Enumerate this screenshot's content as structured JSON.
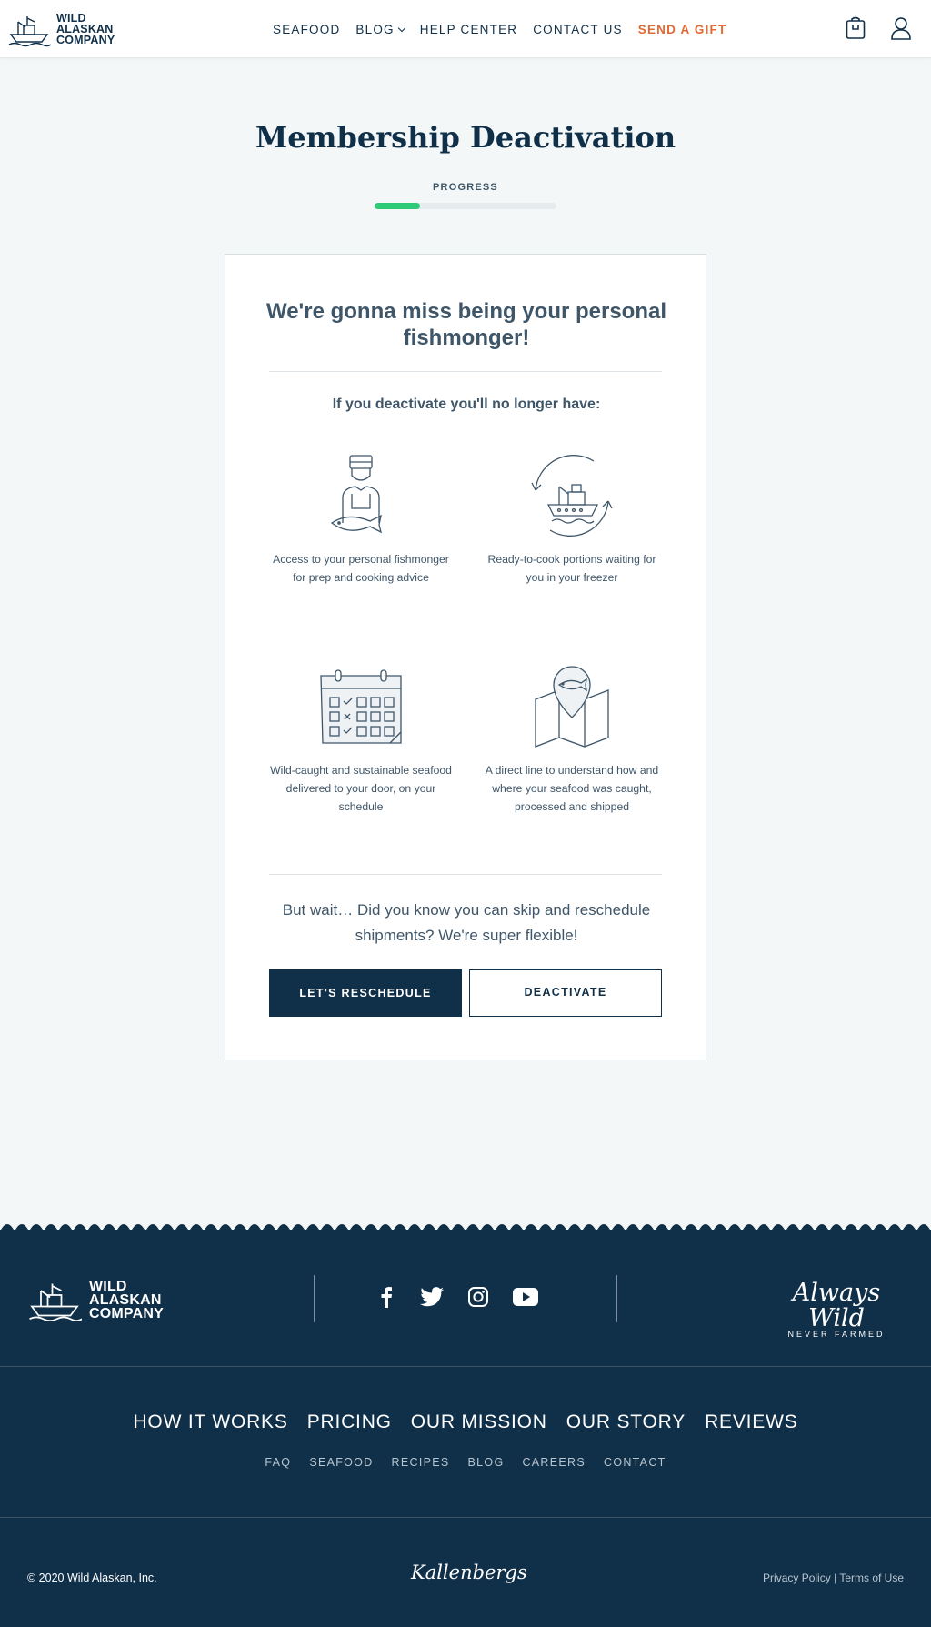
{
  "header": {
    "logo_text": [
      "WILD",
      "ALASKAN",
      "COMPANY"
    ],
    "nav": [
      {
        "label": "SEAFOOD"
      },
      {
        "label": "BLOG",
        "has_dropdown": true
      },
      {
        "label": "HELP CENTER"
      },
      {
        "label": "CONTACT US"
      },
      {
        "label": "SEND A GIFT",
        "accent": "#e26a35"
      }
    ],
    "icons": [
      "shopping-bag-icon",
      "user-icon"
    ]
  },
  "page": {
    "title": "Membership Deactivation",
    "progress_label": "PROGRESS",
    "progress_fraction": 0.25,
    "progress_color": "#2fca78"
  },
  "card": {
    "heading": "We're gonna miss being your personal fishmonger!",
    "subheading": "If you deactivate you'll no longer have:",
    "benefits": [
      {
        "icon": "fishmonger-icon",
        "text": "Access to your personal fishmonger for prep and cooking advice"
      },
      {
        "icon": "fishing-boat-icon",
        "text": "Ready-to-cook portions waiting for you in your freezer"
      },
      {
        "icon": "calendar-icon",
        "text": "Wild-caught and sustainable seafood delivered to your door, on your schedule"
      },
      {
        "icon": "map-pin-fish-icon",
        "text": "A direct line to understand how and where your seafood was caught, processed and shipped"
      }
    ],
    "wait_text": "But wait… Did you know you can skip and reschedule shipments? We're super flexible!",
    "reschedule_label": "LET'S RESCHEDULE",
    "deactivate_label": "DEACTIVATE"
  },
  "footer": {
    "logo_text": [
      "WILD",
      "ALASKAN",
      "COMPANY"
    ],
    "social": [
      "facebook-icon",
      "twitter-icon",
      "instagram-icon",
      "youtube-icon"
    ],
    "tagline_script": "Always Wild",
    "tagline_small": "NEVER FARMED",
    "main_links": [
      "HOW IT WORKS",
      "PRICING",
      "OUR MISSION",
      "OUR STORY",
      "REVIEWS"
    ],
    "sub_links": [
      "FAQ",
      "SEAFOOD",
      "RECIPES",
      "BLOG",
      "CAREERS",
      "CONTACT"
    ],
    "copyright": "© 2020 Wild Alaskan, Inc.",
    "credit": "Kallenbergs",
    "privacy": "Privacy Policy",
    "separator": "|",
    "terms": "Terms of Use",
    "background": "#102f48"
  }
}
